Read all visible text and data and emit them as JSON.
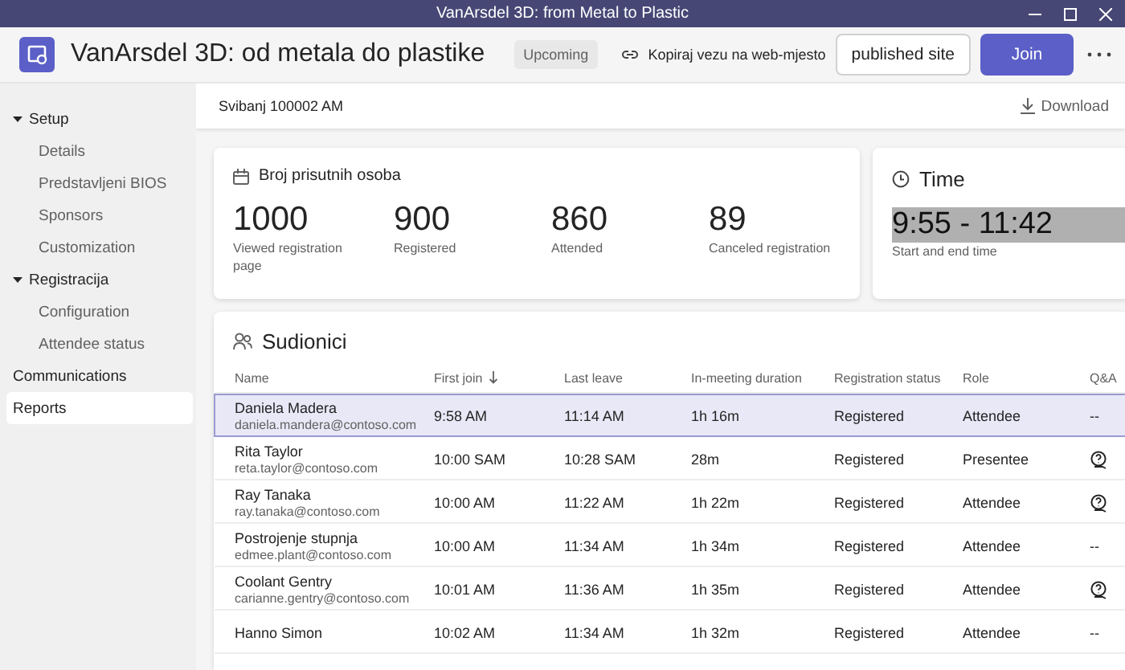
{
  "window": {
    "title": "VanArsdel 3D: from Metal to Plastic"
  },
  "header": {
    "title": "VanArsdel 3D: od metala do plastike",
    "status": "Upcoming",
    "copy_link": "Kopiraj vezu na web-mjesto",
    "site_button": "published site",
    "join_button": "Join"
  },
  "sidebar": {
    "items": [
      {
        "label": "Setup",
        "expanded": true,
        "selected": false,
        "children": [
          {
            "label": "Details",
            "selected": false
          },
          {
            "label": "Predstavljeni BIOS",
            "selected": false
          },
          {
            "label": "Sponsors",
            "selected": false
          },
          {
            "label": "Customization",
            "selected": false
          }
        ]
      },
      {
        "label": "Registracija",
        "expanded": true,
        "selected": false,
        "children": [
          {
            "label": "Configuration",
            "selected": false
          },
          {
            "label": "Attendee status",
            "selected": false
          }
        ]
      },
      {
        "label": "Communications",
        "selected": false
      },
      {
        "label": "Reports",
        "selected": true
      }
    ]
  },
  "report_bar": {
    "date": "Svibanj 100002 AM",
    "download": "Download"
  },
  "attendance": {
    "title": "Broj prisutnih osoba",
    "stats": [
      {
        "value": "1000",
        "label": "Viewed registration page"
      },
      {
        "value": "900",
        "label": "Registered"
      },
      {
        "value": "860",
        "label": "Attended"
      },
      {
        "value": "89",
        "label": "Canceled registration"
      }
    ]
  },
  "time": {
    "title": "Time",
    "value": "9:55 - 11:42",
    "label": "Start and end time"
  },
  "participants": {
    "title": "Sudionici",
    "columns": [
      {
        "label": "Name",
        "sorted": false
      },
      {
        "label": "First join",
        "sorted": true
      },
      {
        "label": "Last leave",
        "sorted": false
      },
      {
        "label": "In-meeting duration",
        "sorted": false
      },
      {
        "label": "Registration status",
        "sorted": false
      },
      {
        "label": "Role",
        "sorted": false
      },
      {
        "label": "Q&A",
        "sorted": false
      }
    ],
    "rows": [
      {
        "name": "Daniela Madera",
        "email": "daniela.mandera@contoso.com",
        "first_join": "9:58 AM",
        "last_leave": "11:14 AM",
        "duration": "1h 16m",
        "status": "Registered",
        "role": "Attendee",
        "qa": {
          "kind": "text",
          "text": "--"
        },
        "selected": true
      },
      {
        "name": "Rita Taylor",
        "email": "reta.taylor@contoso.com",
        "first_join": "10:00 SAM",
        "last_leave": "10:28 SAM",
        "duration": "28m",
        "status": "Registered",
        "role": "Presentee",
        "qa": {
          "kind": "icon"
        },
        "selected": false
      },
      {
        "name": "Ray Tanaka",
        "email": "ray.tanaka@contoso.com",
        "first_join": "10:00 AM",
        "last_leave": "11:22 AM",
        "duration": "1h 22m",
        "status": "Registered",
        "role": "Attendee",
        "qa": {
          "kind": "icon"
        },
        "selected": false
      },
      {
        "name": "Postrojenje stupnja",
        "email": "edmee.plant@contoso.com",
        "first_join": "10:00 AM",
        "last_leave": "11:34 AM",
        "duration": "1h 34m",
        "status": "Registered",
        "role": "Attendee",
        "qa": {
          "kind": "text",
          "text": "--"
        },
        "selected": false
      },
      {
        "name": "Coolant Gentry",
        "email": "carianne.gentry@contoso.com",
        "first_join": "10:01 AM",
        "last_leave": "11:36 AM",
        "duration": "1h 35m",
        "status": "Registered",
        "role": "Attendee",
        "qa": {
          "kind": "icon"
        },
        "selected": false
      },
      {
        "name": "Hanno Simon",
        "first_join": "10:02 AM",
        "last_leave": "11:34 AM",
        "duration": "1h 32m",
        "status": "Registered",
        "role": "Attendee",
        "qa": {
          "kind": "text",
          "text": "--"
        },
        "selected": false
      }
    ]
  }
}
